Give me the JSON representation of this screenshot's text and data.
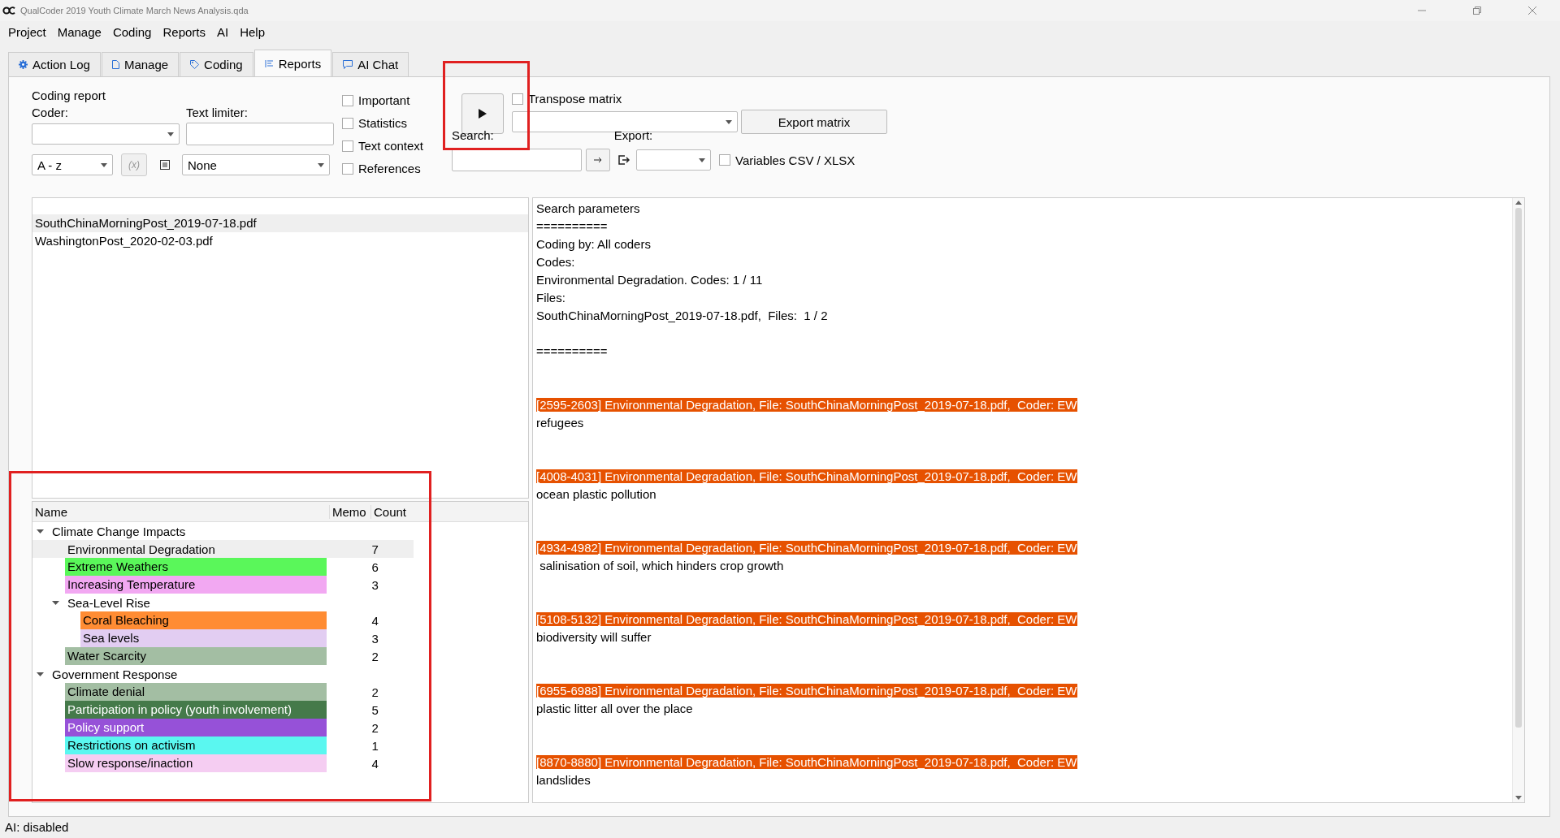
{
  "window": {
    "title": "QualCoder 2019 Youth Climate March News Analysis.qda"
  },
  "menu": [
    "Project",
    "Manage",
    "Coding",
    "Reports",
    "AI",
    "Help"
  ],
  "tabs": [
    {
      "label": "Action Log",
      "selected": false
    },
    {
      "label": "Manage",
      "selected": false
    },
    {
      "label": "Coding",
      "selected": false
    },
    {
      "label": "Reports",
      "selected": true
    },
    {
      "label": "AI Chat",
      "selected": false
    }
  ],
  "options": {
    "heading": "Coding report",
    "coder_label": "Coder:",
    "limiter_label": "Text limiter:",
    "sort": "A - z",
    "formula_button": "(x)",
    "limiter": "None"
  },
  "checkboxes": [
    {
      "label": "Important",
      "checked": false
    },
    {
      "label": "Statistics",
      "checked": false
    },
    {
      "label": "Text context",
      "checked": false
    },
    {
      "label": "References",
      "checked": false
    }
  ],
  "transpose": {
    "label": "Transpose matrix",
    "checked": false
  },
  "export_matrix_button": "Export matrix",
  "search_label": "Search:",
  "export_label": "Export:",
  "variables": {
    "label": "Variables CSV / XLSX",
    "checked": false
  },
  "files": [
    {
      "name": "SouthChinaMorningPost_2019-07-18.pdf",
      "selected": true
    },
    {
      "name": "WashingtonPost_2020-02-03.pdf",
      "selected": false
    }
  ],
  "tree": {
    "columns": [
      "Name",
      "Memo",
      "Count"
    ],
    "items": [
      {
        "name": "Climate Change Impacts",
        "selected": false,
        "expanded": true,
        "children": [
          {
            "name": "Environmental Degradation",
            "count": "7",
            "selected": true
          },
          {
            "name": "Extreme Weathers",
            "count": "6",
            "color": "#5af75a",
            "selected": false
          },
          {
            "name": "Increasing Temperature",
            "count": "3",
            "color": "#f2a8f2",
            "selected": false
          },
          {
            "name": "Sea-Level Rise",
            "selected": false,
            "expanded": true,
            "children": [
              {
                "name": "Coral Bleaching",
                "count": "4",
                "color": "#ff8c33",
                "selected": false
              },
              {
                "name": "Sea levels",
                "count": "3",
                "color": "#e2cdf2",
                "selected": false
              }
            ]
          },
          {
            "name": "Water Scarcity",
            "count": "2",
            "color": "#a3bea3",
            "selected": false
          }
        ]
      },
      {
        "name": "Government Response",
        "selected": false,
        "expanded": true,
        "children": [
          {
            "name": "Climate denial",
            "count": "2",
            "color": "#a3bea3",
            "selected": false
          },
          {
            "name": "Participation in policy (youth involvement)",
            "count": "5",
            "color": "#457a4a",
            "selected": false
          },
          {
            "name": "Policy support",
            "count": "2",
            "color": "#9651d8",
            "selected": false
          },
          {
            "name": "Restrictions on activism",
            "count": "1",
            "color": "#5af7f0",
            "selected": false
          },
          {
            "name": "Slow response/inaction",
            "count": "4",
            "color": "#f5cdf2",
            "selected": false
          }
        ]
      }
    ]
  },
  "report": {
    "parameters": [
      "Search parameters",
      "==========",
      "Coding by: All coders",
      "Codes:",
      "Environmental Degradation. Codes: 1 / 11",
      "Files:",
      "SouthChinaMorningPost_2019-07-18.pdf,  Files:  1 / 2"
    ],
    "separator": "==========",
    "results": [
      {
        "header": "[2595-2603] Environmental Degradation, File: SouthChinaMorningPost_2019-07-18.pdf,  Coder: EW",
        "text": "refugees"
      },
      {
        "header": "[4008-4031] Environmental Degradation, File: SouthChinaMorningPost_2019-07-18.pdf,  Coder: EW",
        "text": "ocean plastic pollution"
      },
      {
        "header": "[4934-4982] Environmental Degradation, File: SouthChinaMorningPost_2019-07-18.pdf,  Coder: EW",
        "text": " salinisation of soil, which hinders crop growth"
      },
      {
        "header": "[5108-5132] Environmental Degradation, File: SouthChinaMorningPost_2019-07-18.pdf,  Coder: EW",
        "text": "biodiversity will suffer"
      },
      {
        "header": "[6955-6988] Environmental Degradation, File: SouthChinaMorningPost_2019-07-18.pdf,  Coder: EW",
        "text": "plastic litter all over the place"
      },
      {
        "header": "[8870-8880] Environmental Degradation, File: SouthChinaMorningPost_2019-07-18.pdf,  Coder: EW",
        "text": "landslides"
      }
    ]
  },
  "status_bar": "AI: disabled"
}
